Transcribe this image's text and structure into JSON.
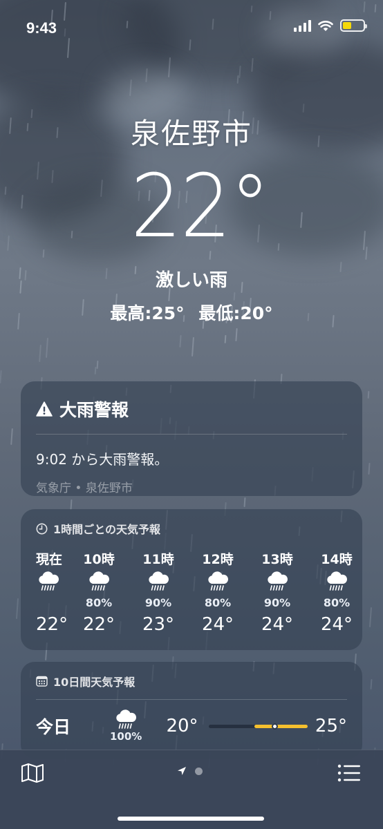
{
  "status": {
    "time": "9:43",
    "battery_color": "#f5d90a"
  },
  "location": {
    "city": "泉佐野市",
    "temperature": "22°",
    "condition": "激しい雨",
    "high": "最高:25°",
    "low": "最低:20°"
  },
  "alert": {
    "title": "大雨警報",
    "body": "9:02 から大雨警報。",
    "source": "気象庁 • 泉佐野市",
    "icon": "warning-triangle-icon"
  },
  "hourly": {
    "header": "1時間ごとの天気予報",
    "icon": "clock-icon",
    "items": [
      {
        "label": "現在",
        "pop": "",
        "temp": "22°",
        "icon": "heavy-rain-icon"
      },
      {
        "label": "10時",
        "pop": "80%",
        "temp": "22°",
        "icon": "heavy-rain-icon"
      },
      {
        "label": "11時",
        "pop": "90%",
        "temp": "23°",
        "icon": "heavy-rain-icon"
      },
      {
        "label": "12時",
        "pop": "80%",
        "temp": "24°",
        "icon": "heavy-rain-icon"
      },
      {
        "label": "13時",
        "pop": "90%",
        "temp": "24°",
        "icon": "heavy-rain-icon"
      },
      {
        "label": "14時",
        "pop": "80%",
        "temp": "24°",
        "icon": "heavy-rain-icon"
      }
    ]
  },
  "daily": {
    "header": "10日間天気予報",
    "icon": "calendar-icon",
    "items": [
      {
        "day": "今日",
        "pop": "100%",
        "low": "20°",
        "high": "25°",
        "icon": "heavy-rain-icon",
        "range_color": "#f5c02e"
      }
    ]
  },
  "toolbar": {
    "map_icon": "map-icon",
    "location_icon": "location-arrow-icon",
    "list_icon": "list-icon"
  }
}
